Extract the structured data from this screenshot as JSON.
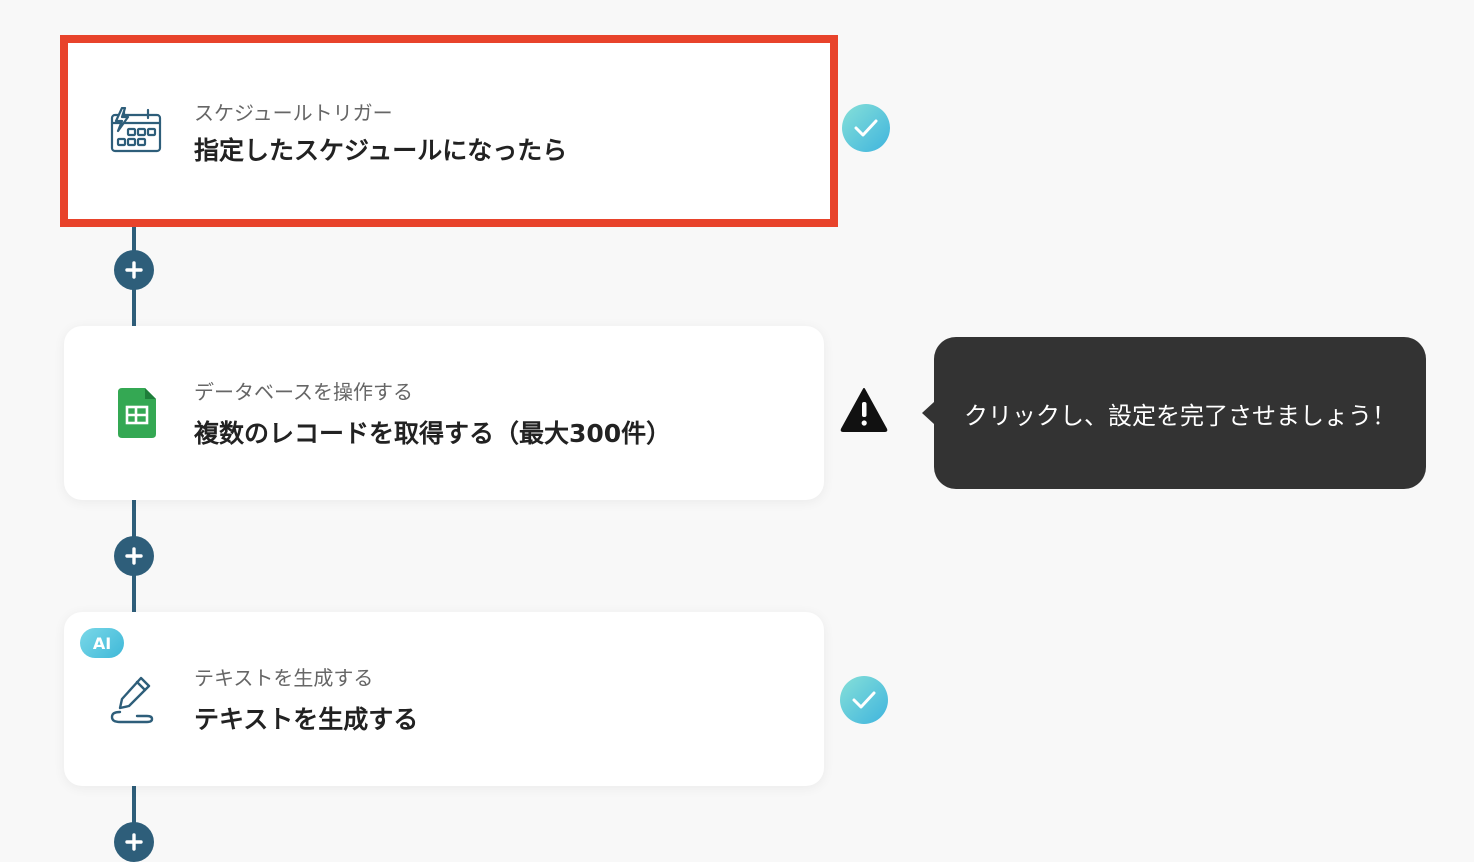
{
  "steps": [
    {
      "subtitle": "スケジュールトリガー",
      "title": "指定したスケジュールになったら",
      "icon": "calendar-schedule-icon",
      "status": "complete",
      "selected": true
    },
    {
      "subtitle": "データベースを操作する",
      "title": "複数のレコードを取得する（最大300件）",
      "icon": "google-sheets-icon",
      "status": "warning",
      "selected": false
    },
    {
      "subtitle": "テキストを生成する",
      "title": "テキストを生成する",
      "icon": "pencil-write-icon",
      "status": "complete",
      "badge": "AI",
      "selected": false
    }
  ],
  "tooltip": {
    "text": "クリックし、設定を完了させましょう！"
  },
  "colors": {
    "connector": "#2e5e7a",
    "selected_border": "#e8432b",
    "check_gradient_start": "#86e0d8",
    "check_gradient_end": "#3fb4de",
    "sheets_green": "#34a853",
    "tooltip_bg": "#333333"
  }
}
